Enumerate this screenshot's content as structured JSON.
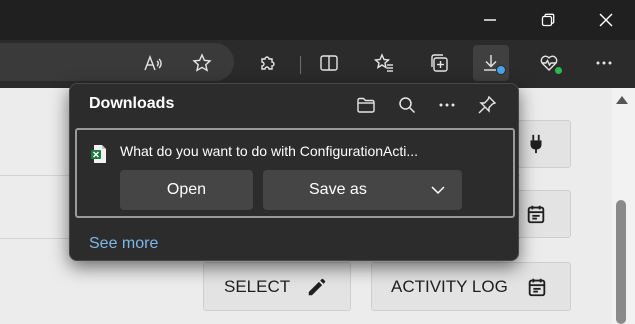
{
  "downloads": {
    "title": "Downloads",
    "item": {
      "question": "What do you want to do with ConfigurationActi...",
      "file_icon": "excel-file-icon",
      "open_label": "Open",
      "save_as_label": "Save as"
    },
    "see_more": "See more"
  },
  "page_buttons": {
    "select_label": "SELECT",
    "activity_log_label": "ACTIVITY LOG"
  },
  "colors": {
    "link": "#7fb7e6",
    "download_badge": "#4aa3e8",
    "health_dot": "#2fb84f"
  }
}
